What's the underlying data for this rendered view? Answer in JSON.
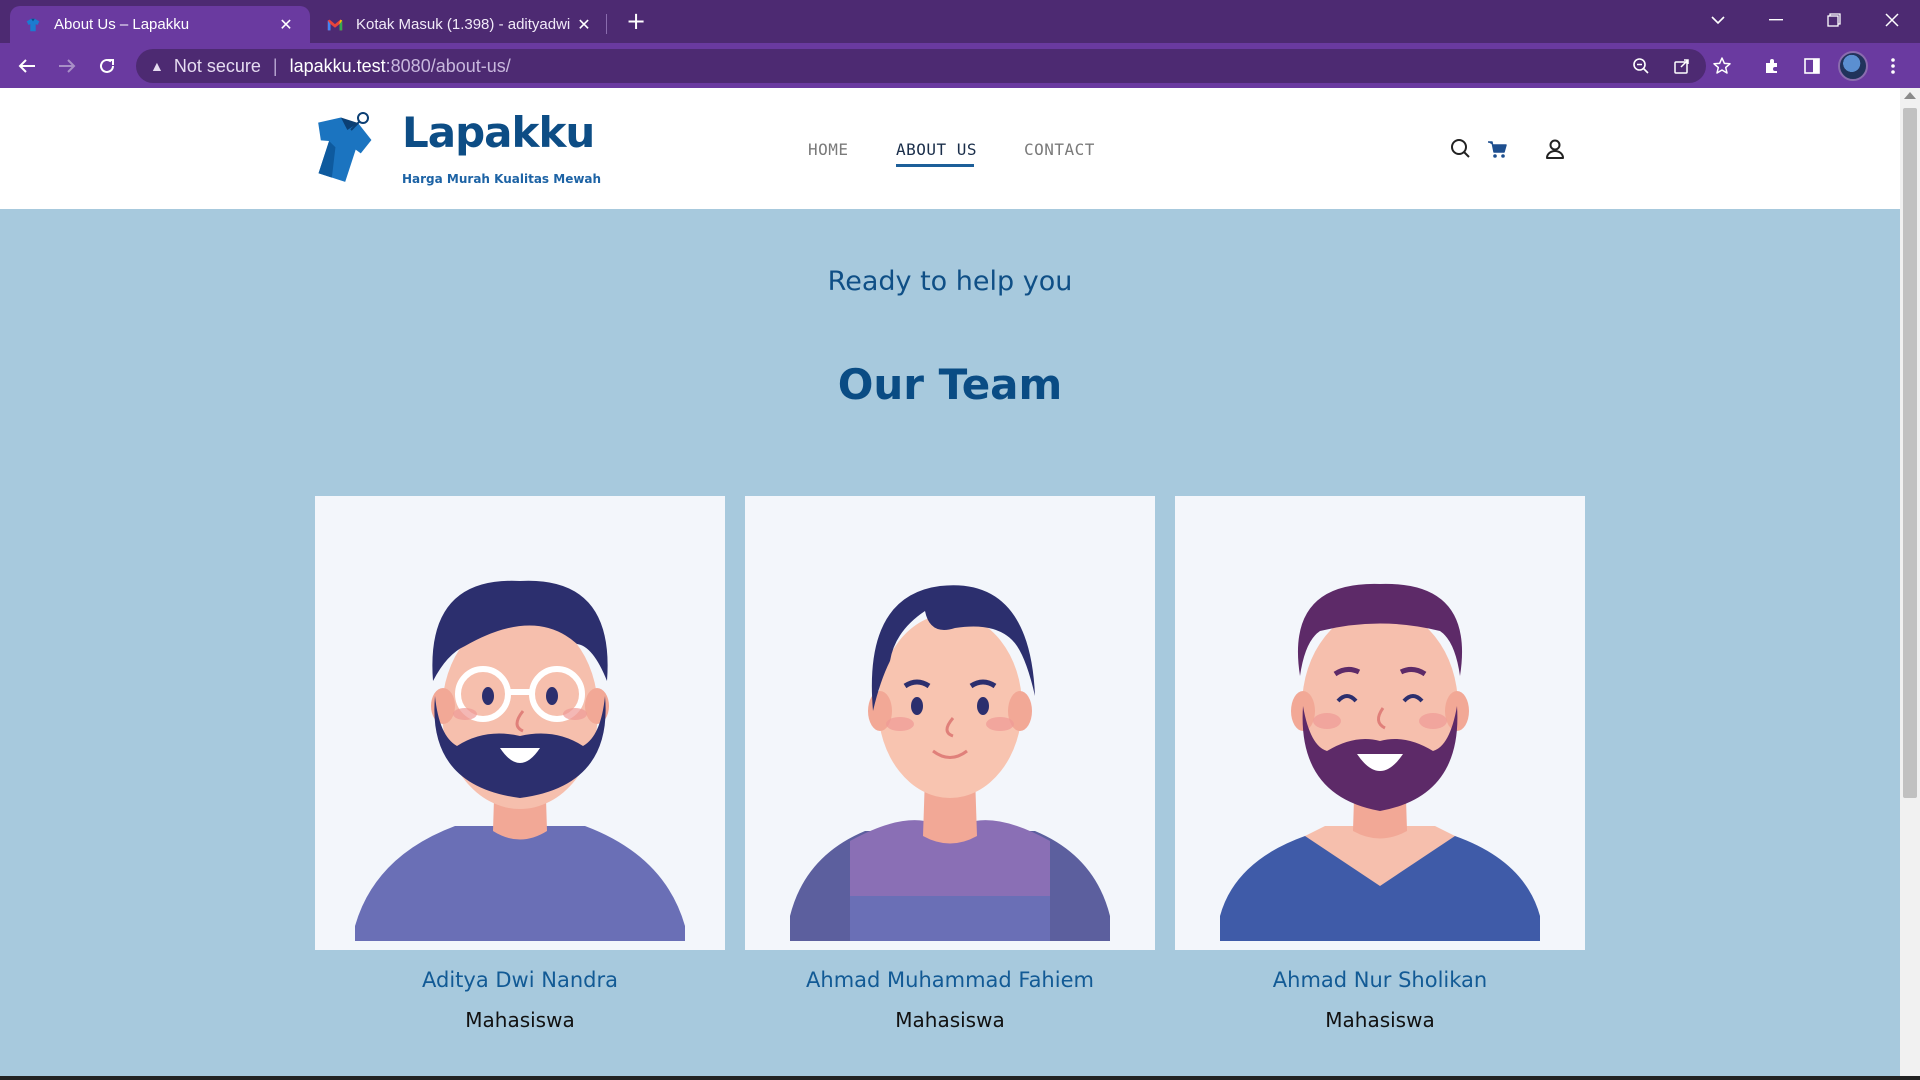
{
  "browser": {
    "tabs": [
      {
        "title": "About Us – Lapakku",
        "favicon": "lapakku-shirt-icon",
        "active": true
      },
      {
        "title": "Kotak Masuk (1.398) - adityadwi",
        "favicon": "gmail-icon",
        "active": false
      }
    ],
    "address": {
      "security_label": "Not secure",
      "host": "lapakku.test",
      "path": ":8080/about-us/"
    },
    "toolbar_icons": [
      "zoom-icon",
      "share-icon",
      "bookmark-star-icon",
      "extensions-icon",
      "side-panel-icon",
      "profile-avatar",
      "menu-dots-icon"
    ],
    "accent": "#6a3aa0",
    "tabbar_color": "#4d2a72"
  },
  "site": {
    "brand": "Lapakku",
    "tagline": "Harga Murah Kualitas Mewah",
    "nav": [
      {
        "label": "HOME",
        "active": false
      },
      {
        "label": "ABOUT US",
        "active": true
      },
      {
        "label": "CONTACT",
        "active": false
      }
    ],
    "header_icons": [
      "search-icon",
      "cart-icon",
      "user-icon"
    ],
    "brand_color": "#0d4d85",
    "background_color": "#a7c9dd"
  },
  "hero": {
    "pre_title": "Ready to help you",
    "title": "Our Team"
  },
  "team": [
    {
      "name": "Aditya Dwi Nandra",
      "role": "Mahasiswa",
      "avatar": "bearded-glasses-avatar"
    },
    {
      "name": "Ahmad Muhammad Fahiem",
      "role": "Mahasiswa",
      "avatar": "young-man-avatar"
    },
    {
      "name": "Ahmad Nur Sholikan",
      "role": "Mahasiswa",
      "avatar": "bearded-smiling-avatar"
    }
  ]
}
